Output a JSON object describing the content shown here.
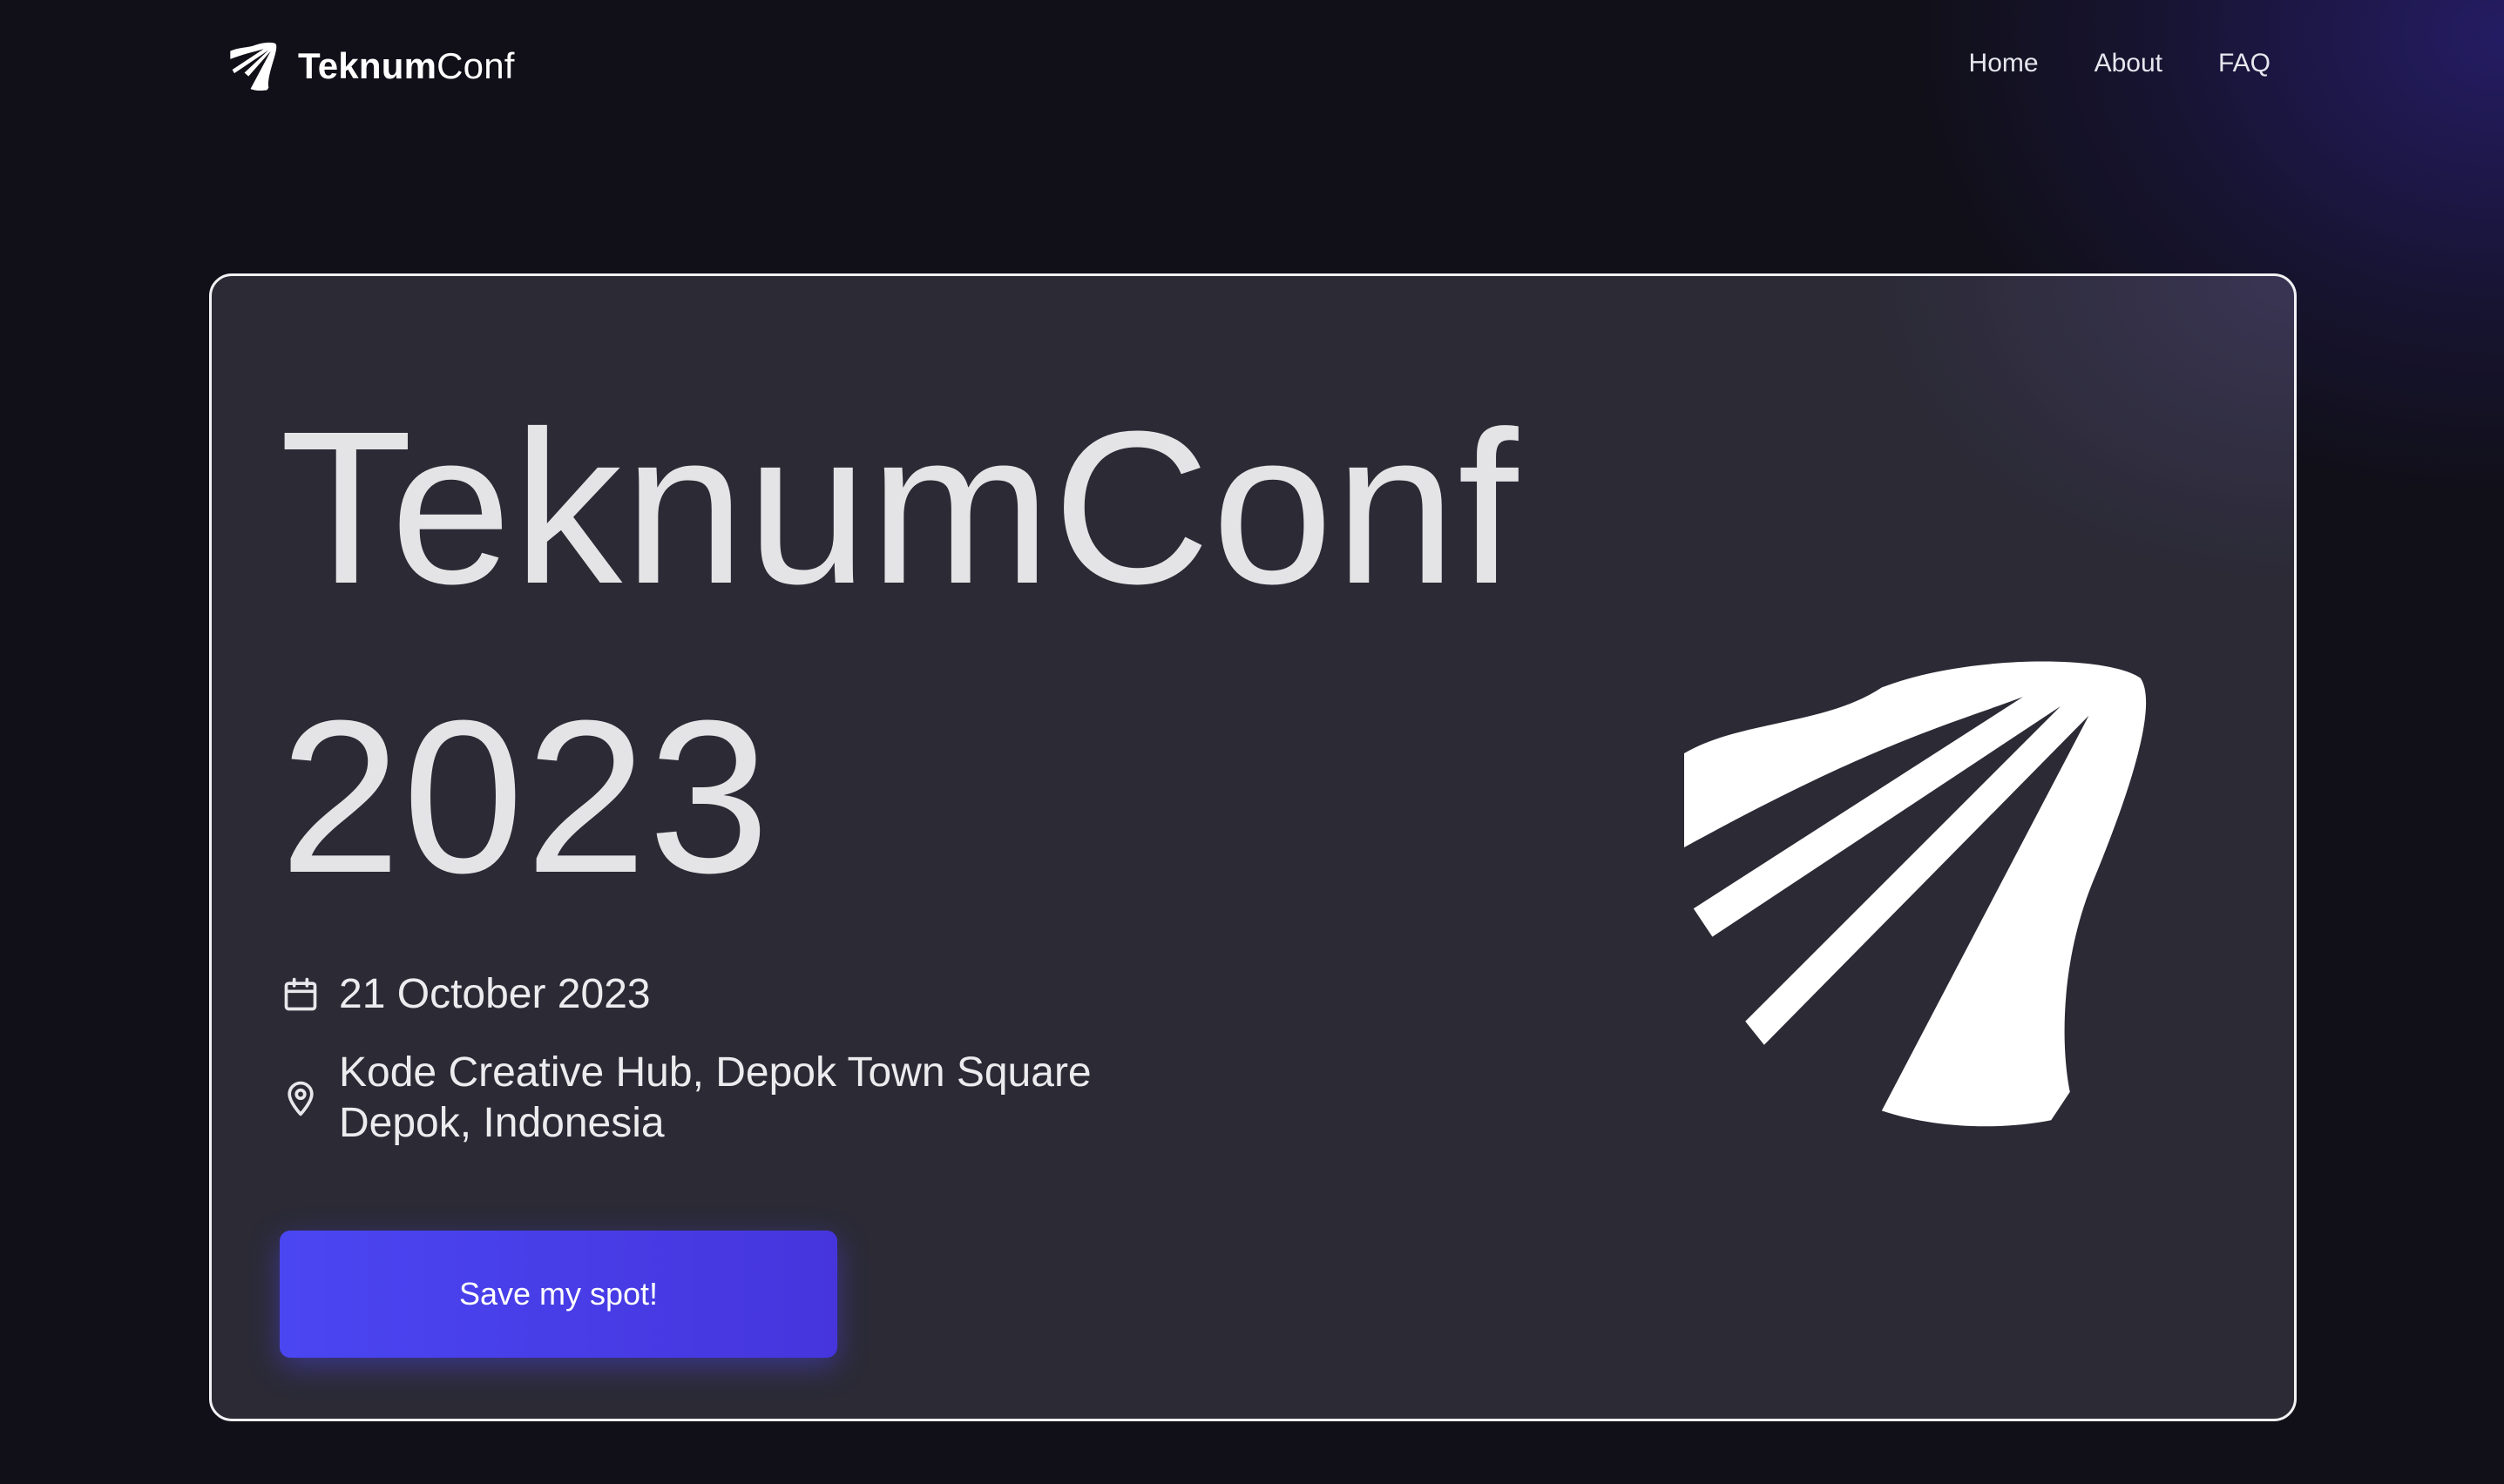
{
  "navbar": {
    "brand": {
      "icon": "teknumconf-logo-icon",
      "bold": "Teknum",
      "light": "Conf"
    },
    "links": [
      {
        "label": "Home"
      },
      {
        "label": "About"
      },
      {
        "label": "FAQ"
      }
    ]
  },
  "hero": {
    "title_line1": "TeknumConf",
    "title_line2": "2023",
    "date": {
      "icon": "calendar-icon",
      "text": "21 October 2023"
    },
    "location": {
      "icon": "map-pin-icon",
      "line1": "Kode Creative Hub, Depok Town Square",
      "line2": "Depok, Indonesia"
    },
    "cta_label": "Save my spot!",
    "logo_icon": "teknumconf-logo-icon"
  },
  "colors": {
    "page_background": "#111019",
    "card_background": "#2b2a35",
    "card_border": "#f2f2f5",
    "accent": "#4a46f2",
    "text": "#e4e4e6"
  }
}
